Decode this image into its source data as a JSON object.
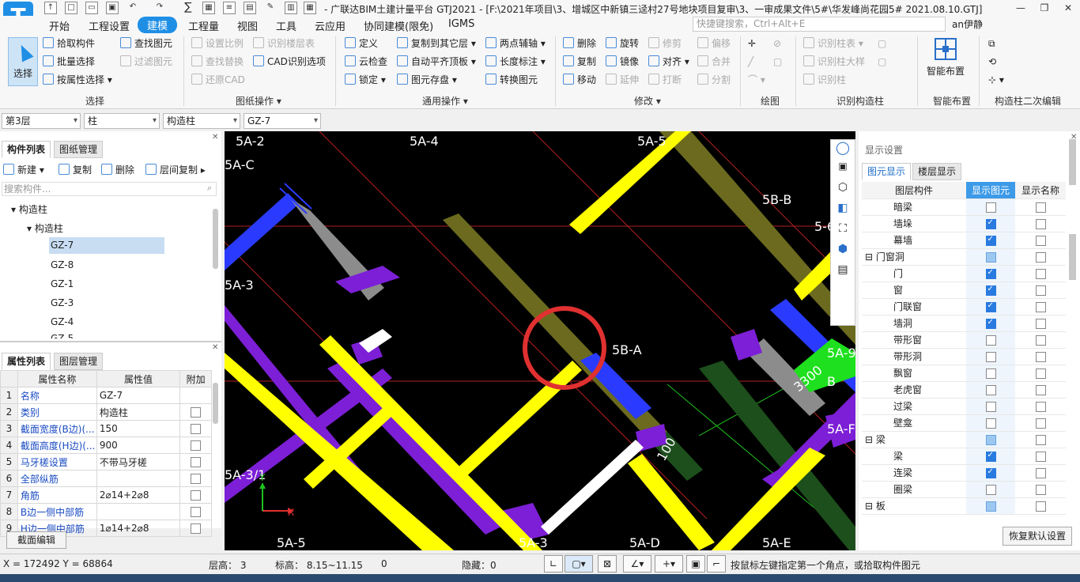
{
  "app": {
    "logo": "T",
    "title": "- 广联达BIM土建计量平台 GTJ2021 - [F:\\2021年项目\\3、增城区中新镇三迳村27号地块项目复审\\3、一审成果文件\\5#\\华发峰尚花园5# 2021.08.10.GTJ]",
    "user": "an伊静",
    "search_placeholder": "快捷键搜索，Ctrl+Alt+E"
  },
  "menu": [
    "开始",
    "工程设置",
    "建模",
    "工程量",
    "视图",
    "工具",
    "云应用",
    "协同建模(限免)",
    "IGMS"
  ],
  "menu_active": "建模",
  "ribbon": {
    "select": {
      "big": "选择",
      "items": [
        "拾取构件",
        "批量选择",
        "按属性选择",
        "查找图元",
        "过滤图元"
      ],
      "group": "选择"
    },
    "drawing": {
      "items": [
        "设置比例",
        "识别楼层表",
        "查找替换",
        "CAD识别选项",
        "还原CAD"
      ],
      "group": "图纸操作"
    },
    "common": {
      "items": [
        "定义",
        "复制到其它层",
        "两点辅轴",
        "云检查",
        "自动平齐顶板",
        "长度标注",
        "锁定",
        "图元存盘",
        "转换图元"
      ],
      "group": "通用操作"
    },
    "modify": {
      "items": [
        "删除",
        "旋转",
        "修剪",
        "偏移",
        "复制",
        "镜像",
        "对齐",
        "合并",
        "移动",
        "延伸",
        "打断",
        "分割"
      ],
      "group": "修改"
    },
    "draw": {
      "group": "绘图"
    },
    "recog": {
      "items": [
        "识别柱表",
        "识别柱大样",
        "识别柱"
      ],
      "group": "识别构造柱"
    },
    "smart": {
      "big": "智能布置",
      "group": "智能布置"
    },
    "second": {
      "group": "构造柱二次编辑"
    }
  },
  "selectors": {
    "floor": "第3层",
    "type": "柱",
    "subtype": "构造柱",
    "element": "GZ-7"
  },
  "left": {
    "tabs": [
      "构件列表",
      "图纸管理"
    ],
    "toolbar": [
      "新建",
      "复制",
      "删除",
      "层间复制"
    ],
    "search_placeholder": "搜索构件...",
    "tree_root": "构造柱",
    "tree_child": "构造柱",
    "items": [
      "GZ-7",
      "GZ-8",
      "GZ-1",
      "GZ-3",
      "GZ-4",
      "GZ-5"
    ],
    "prop_tabs": [
      "属性列表",
      "图层管理"
    ],
    "prop_headers": [
      "属性名称",
      "属性值",
      "附加"
    ],
    "props": [
      {
        "no": "1",
        "name": "名称",
        "value": "GZ-7",
        "cb": false
      },
      {
        "no": "2",
        "name": "类别",
        "value": "构造柱",
        "cb": true
      },
      {
        "no": "3",
        "name": "截面宽度(B边)(...",
        "value": "150",
        "cb": true
      },
      {
        "no": "4",
        "name": "截面高度(H边)(...",
        "value": "900",
        "cb": true
      },
      {
        "no": "5",
        "name": "马牙槎设置",
        "value": "不带马牙槎",
        "cb": true
      },
      {
        "no": "6",
        "name": "全部纵筋",
        "value": "",
        "cb": true
      },
      {
        "no": "7",
        "name": "角筋",
        "value": "2⌀14+2⌀8",
        "cb": true
      },
      {
        "no": "8",
        "name": "B边一侧中部筋",
        "value": "",
        "cb": true
      },
      {
        "no": "9",
        "name": "H边一侧中部筋",
        "value": "1⌀14+2⌀8",
        "cb": true
      }
    ],
    "section_edit": "截面编辑"
  },
  "canvas": {
    "axes": [
      "5A-2",
      "5A-4",
      "5A-5",
      "5A-C",
      "5B-B",
      "5-6",
      "5A-3",
      "5B-A",
      "5A-9",
      "3300",
      "B",
      "5A-F",
      "5A-3/1",
      "5A-5",
      "5A-3",
      "5A-D",
      "5A-E",
      "100"
    ],
    "colors": {
      "background": "#000000",
      "yellow": "#ffff00",
      "purple": "#7d1fd6",
      "blue": "#2a3bff",
      "olive": "#6b6a1e",
      "gray": "#8c8c8c",
      "red": "#e03030",
      "green": "#1ec21e",
      "white": "#ffffff"
    }
  },
  "right": {
    "title": "显示设置",
    "tabs": [
      "图元显示",
      "楼层显示"
    ],
    "headers": [
      "图层构件",
      "显示图元",
      "显示名称"
    ],
    "rows": [
      {
        "name": "暗梁",
        "show": false,
        "name_show": false,
        "group": false
      },
      {
        "name": "墙垛",
        "show": true,
        "name_show": false,
        "group": false
      },
      {
        "name": "幕墙",
        "show": true,
        "name_show": false,
        "group": false
      },
      {
        "name": "门窗洞",
        "show": "part",
        "name_show": false,
        "group": true
      },
      {
        "name": "门",
        "show": true,
        "name_show": false,
        "group": false
      },
      {
        "name": "窗",
        "show": true,
        "name_show": false,
        "group": false
      },
      {
        "name": "门联窗",
        "show": true,
        "name_show": false,
        "group": false
      },
      {
        "name": "墙洞",
        "show": true,
        "name_show": false,
        "group": false
      },
      {
        "name": "带形窗",
        "show": false,
        "name_show": false,
        "group": false
      },
      {
        "name": "带形洞",
        "show": false,
        "name_show": false,
        "group": false
      },
      {
        "name": "飘窗",
        "show": false,
        "name_show": false,
        "group": false
      },
      {
        "name": "老虎窗",
        "show": false,
        "name_show": false,
        "group": false
      },
      {
        "name": "过梁",
        "show": false,
        "name_show": false,
        "group": false
      },
      {
        "name": "壁龛",
        "show": false,
        "name_show": false,
        "group": false
      },
      {
        "name": "梁",
        "show": "part",
        "name_show": false,
        "group": true
      },
      {
        "name": "梁",
        "show": true,
        "name_show": false,
        "group": false
      },
      {
        "name": "连梁",
        "show": true,
        "name_show": false,
        "group": false
      },
      {
        "name": "圈梁",
        "show": false,
        "name_show": false,
        "group": false
      },
      {
        "name": "板",
        "show": "part",
        "name_show": false,
        "group": true
      }
    ],
    "restore": "恢复默认设置"
  },
  "status": {
    "coords": "X = 172492 Y = 68864",
    "floor_height": "层高： 3",
    "elevation": "标高： 8.15~11.15",
    "count": "0",
    "hidden": "隐藏：0",
    "hint": "按鼠标左键指定第一个角点，或拾取构件图元"
  }
}
